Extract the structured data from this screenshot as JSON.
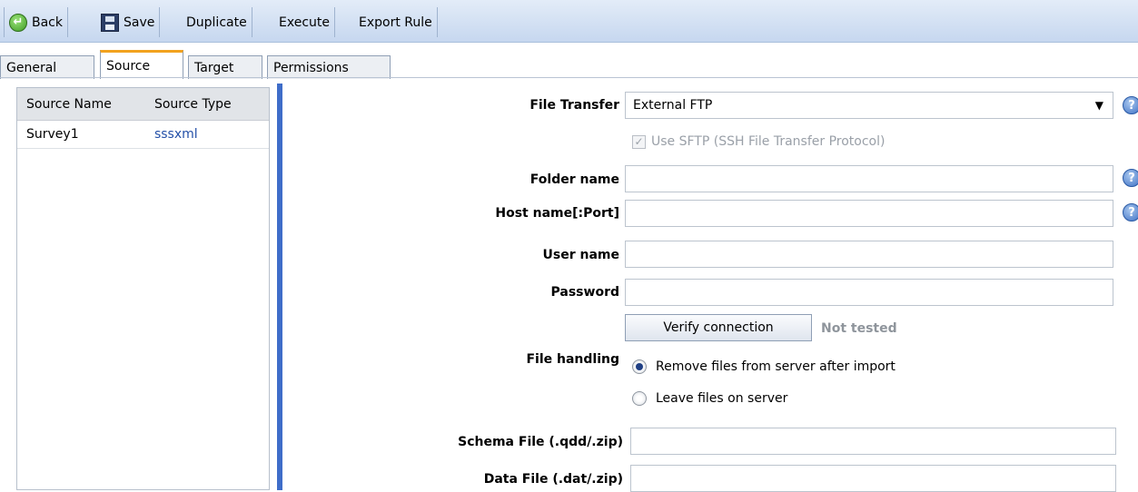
{
  "toolbar": {
    "back_label": "Back",
    "save_label": "Save",
    "duplicate_label": "Duplicate",
    "execute_label": "Execute",
    "export_label": "Export Rule"
  },
  "tabs": [
    {
      "label": "General",
      "active": false
    },
    {
      "label": "Source",
      "active": true
    },
    {
      "label": "Target",
      "active": false
    },
    {
      "label": "Permissions",
      "active": false
    }
  ],
  "sources": {
    "headers": [
      "Source Name",
      "Source Type"
    ],
    "rows": [
      {
        "name": "Survey1",
        "type": "sssxml"
      }
    ]
  },
  "form": {
    "file_transfer_label": "File Transfer",
    "file_transfer_value": "External FTP",
    "sftp_label": "Use SFTP (SSH File Transfer Protocol)",
    "sftp_checked": true,
    "folder_label": "Folder name",
    "folder_value": "",
    "host_label": "Host name[:Port]",
    "host_value": "",
    "user_label": "User name",
    "user_value": "",
    "password_label": "Password",
    "password_value": "",
    "verify_label": "Verify connection",
    "verify_status": "Not tested",
    "file_handling_label": "File handling",
    "file_handling_options": [
      {
        "label": "Remove files from server after import",
        "selected": true
      },
      {
        "label": "Leave files on server",
        "selected": false
      }
    ],
    "schema_label": "Schema File (.qdd/.zip)",
    "schema_value": "",
    "data_label": "Data File (.dat/.zip)",
    "data_value": ""
  },
  "icons": {
    "back": "back-arrow-icon",
    "save": "floppy-disk-icon",
    "help": "help-icon",
    "dropdown": "chevron-down-icon"
  },
  "colors": {
    "accent_bar": "#3f6dc9",
    "active_tab": "#f2a21f",
    "link": "#2450a8"
  }
}
